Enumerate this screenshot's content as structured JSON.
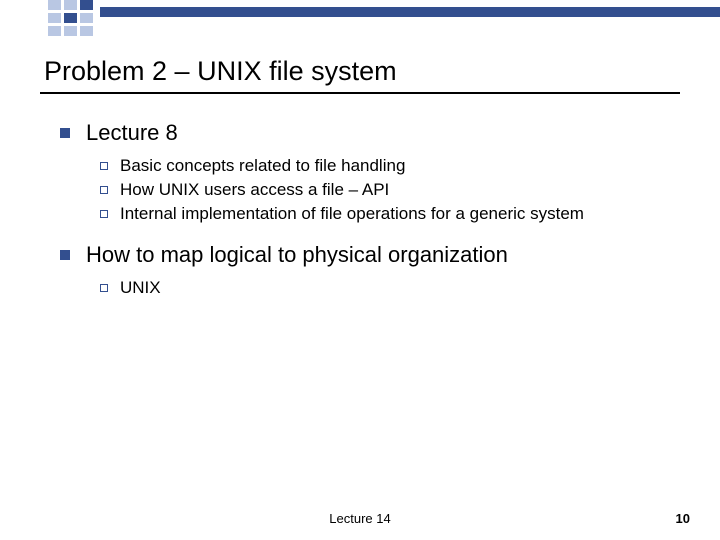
{
  "title": "Problem 2 – UNIX file system",
  "sections": [
    {
      "label": "Lecture 8",
      "items": [
        "Basic concepts related to file handling",
        "How UNIX users access a file – API",
        "Internal implementation of file operations for a generic system"
      ]
    },
    {
      "label": "How to map logical to physical organization",
      "items": [
        "UNIX"
      ]
    }
  ],
  "footer": {
    "center": "Lecture 14",
    "page": "10"
  }
}
